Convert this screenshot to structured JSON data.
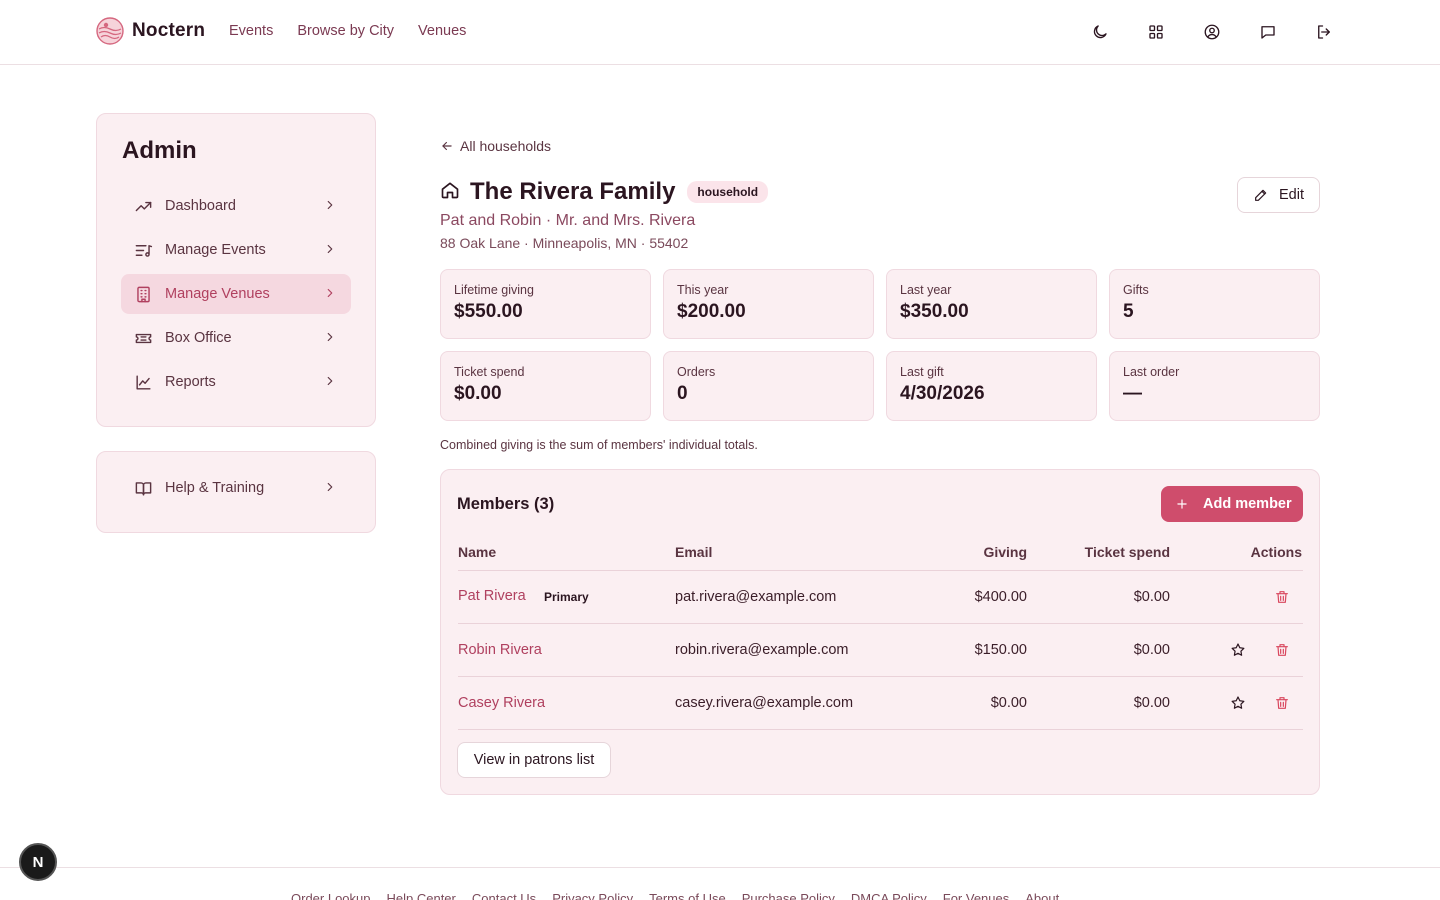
{
  "brand": {
    "name": "Noctern"
  },
  "nav": {
    "links": [
      "Events",
      "Browse by City",
      "Venues"
    ]
  },
  "sidebar": {
    "title": "Admin",
    "items": [
      {
        "label": "Dashboard",
        "icon": "trending-up-icon"
      },
      {
        "label": "Manage Events",
        "icon": "list-music-icon"
      },
      {
        "label": "Manage Venues",
        "icon": "building-icon",
        "active": true
      },
      {
        "label": "Box Office",
        "icon": "ticket-icon"
      },
      {
        "label": "Reports",
        "icon": "line-chart-icon"
      }
    ],
    "help": {
      "label": "Help & Training",
      "icon": "book-open-icon"
    }
  },
  "household": {
    "back_label": "All households",
    "title": "The Rivera Family",
    "badge": "household",
    "subtitle": "Pat and Robin · Mr. and Mrs. Rivera",
    "address": "88 Oak Lane · Minneapolis, MN · 55402",
    "edit_label": "Edit"
  },
  "stats": [
    {
      "label": "Lifetime giving",
      "value": "$550.00"
    },
    {
      "label": "This year",
      "value": "$200.00"
    },
    {
      "label": "Last year",
      "value": "$350.00"
    },
    {
      "label": "Gifts",
      "value": "5"
    },
    {
      "label": "Ticket spend",
      "value": "$0.00"
    },
    {
      "label": "Orders",
      "value": "0"
    },
    {
      "label": "Last gift",
      "value": "4/30/2026"
    },
    {
      "label": "Last order",
      "value": "—"
    }
  ],
  "note": "Combined giving is the sum of members' individual totals.",
  "members": {
    "title": "Members (3)",
    "add_label": "Add member",
    "columns": [
      "Name",
      "Email",
      "Giving",
      "Ticket spend",
      "Actions"
    ],
    "rows": [
      {
        "name": "Pat Rivera",
        "badge": "Primary",
        "email": "pat.rivera@example.com",
        "giving": "$400.00",
        "ticket_spend": "$0.00"
      },
      {
        "name": "Robin Rivera",
        "email": "robin.rivera@example.com",
        "giving": "$150.00",
        "ticket_spend": "$0.00"
      },
      {
        "name": "Casey Rivera",
        "email": "casey.rivera@example.com",
        "giving": "$0.00",
        "ticket_spend": "$0.00"
      }
    ],
    "view_label": "View in patrons list"
  },
  "footer": {
    "links": [
      "Order Lookup",
      "Help Center",
      "Contact Us",
      "Privacy Policy",
      "Terms of Use",
      "Purchase Policy",
      "DMCA Policy",
      "For Venues",
      "About"
    ]
  },
  "dev_badge": "N",
  "colors": {
    "accent": "#cf4d6c",
    "link": "#b0405f",
    "card_bg": "#fbeff2",
    "danger": "#d9475e"
  }
}
